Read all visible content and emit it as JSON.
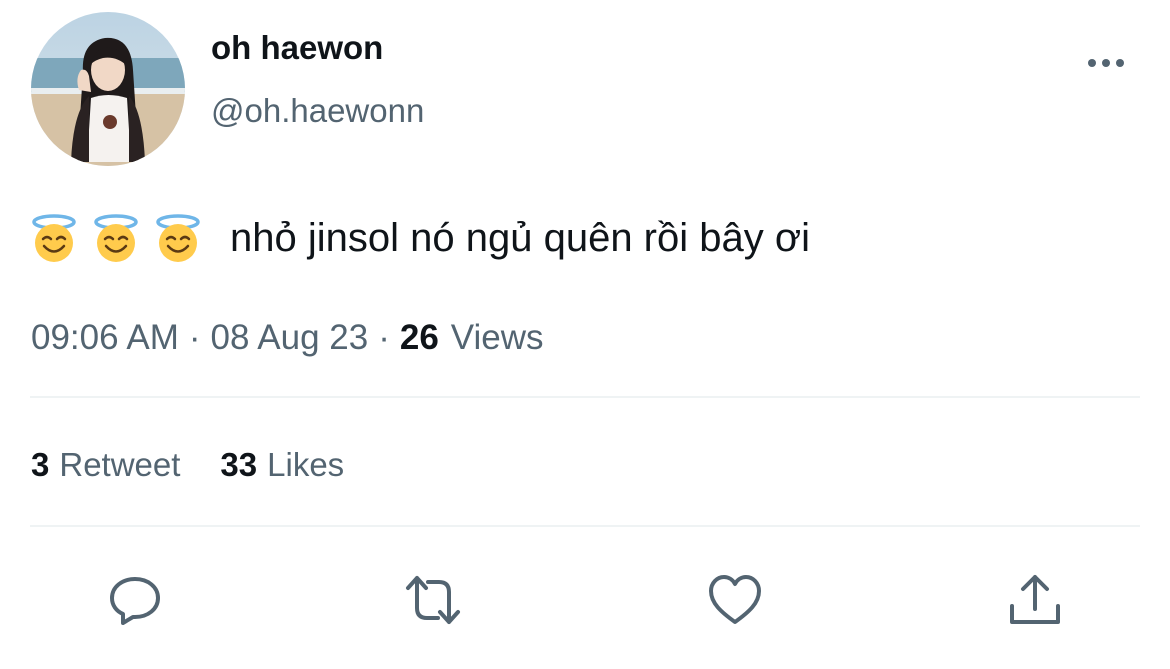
{
  "author": {
    "display_name": "oh haewon",
    "handle": "@oh.haewonn"
  },
  "tweet": {
    "emojis": [
      "smiling-face-with-halo",
      "smiling-face-with-halo",
      "smiling-face-with-halo"
    ],
    "text": "nhỏ jinsol nó ngủ quên rồi bây ơi",
    "time": "09:06 AM",
    "separator": "·",
    "date": "08 Aug 23",
    "views_count": "26",
    "views_label": "Views"
  },
  "stats": {
    "retweets_count": "3",
    "retweets_label": "Retweet",
    "likes_count": "33",
    "likes_label": "Likes"
  },
  "actions": [
    "reply-icon",
    "retweet-icon",
    "like-icon",
    "share-icon"
  ],
  "colors": {
    "text_primary": "#0f1419",
    "text_secondary": "#536471",
    "icon": "#536471",
    "divider": "#eff3f4"
  }
}
